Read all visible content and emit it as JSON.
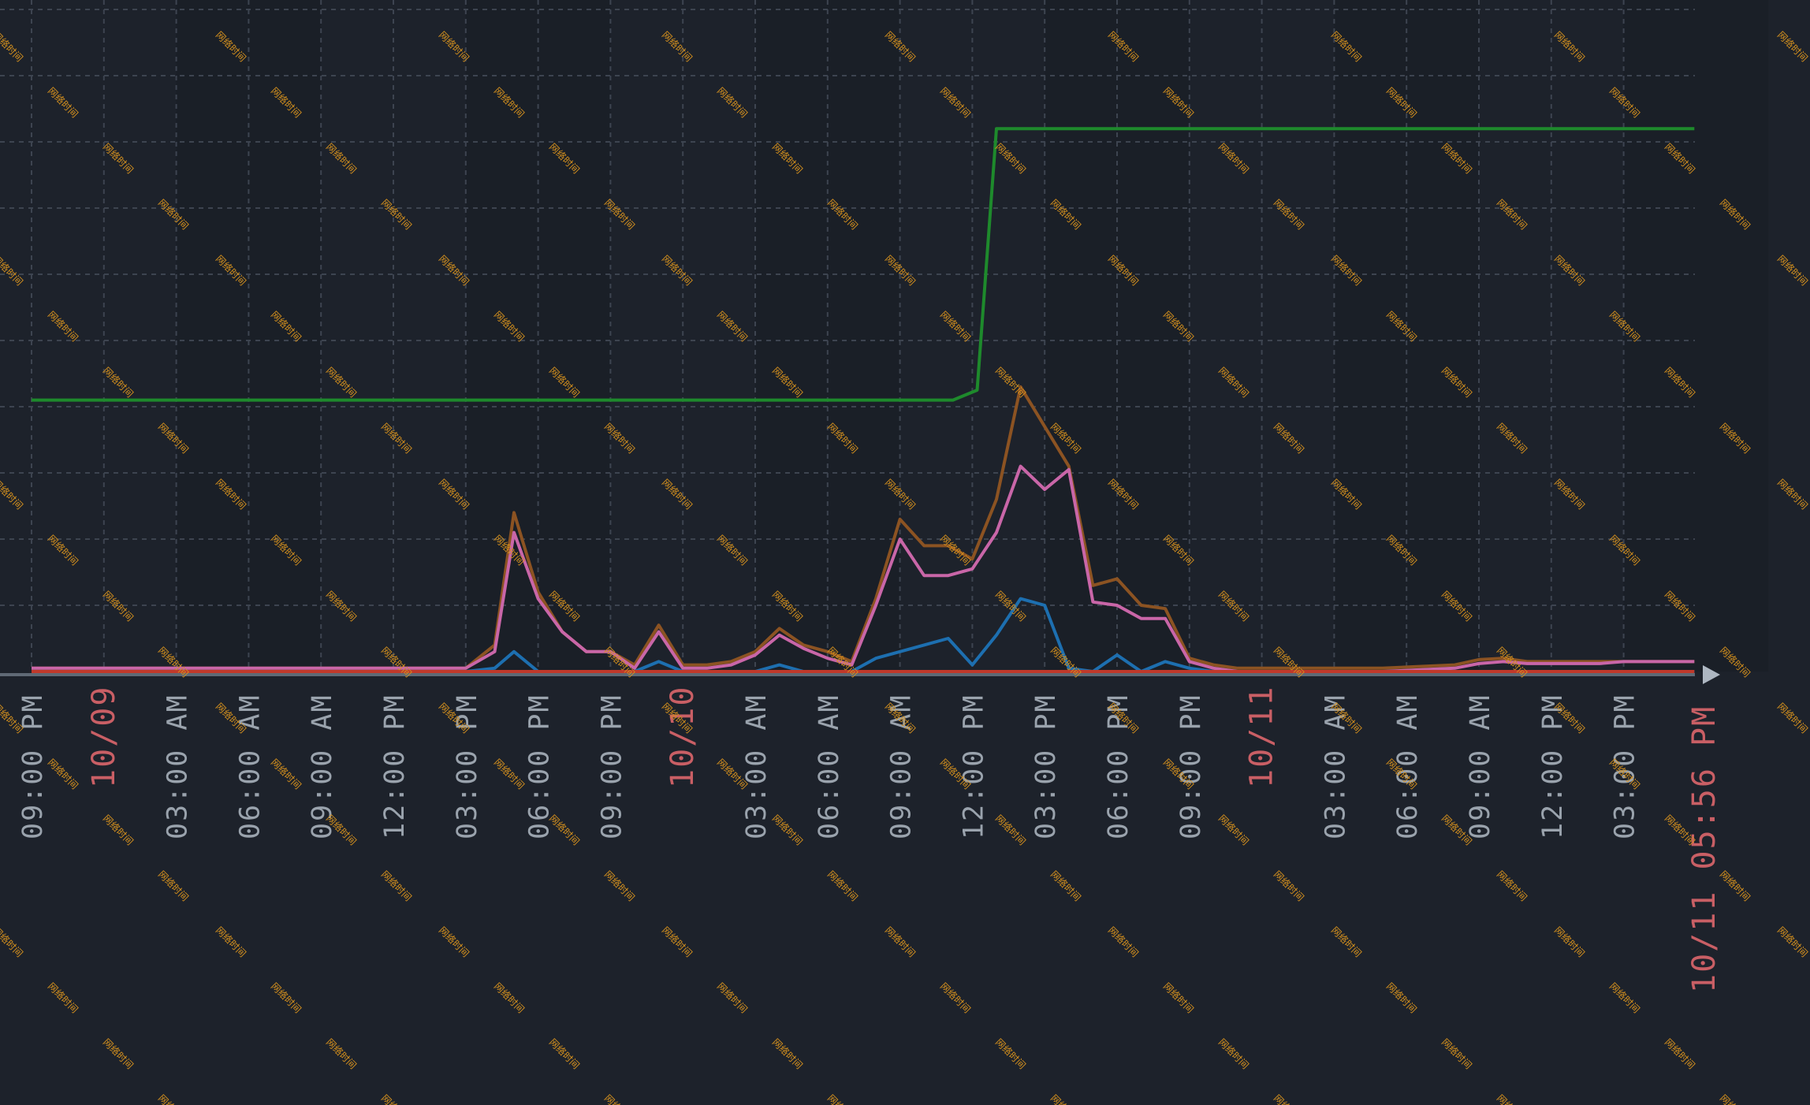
{
  "chart_data": {
    "type": "line",
    "x_labels": [
      {
        "text": "09:00 PM",
        "style": "time"
      },
      {
        "text": "10/09",
        "style": "date"
      },
      {
        "text": "03:00 AM",
        "style": "time"
      },
      {
        "text": "06:00 AM",
        "style": "time"
      },
      {
        "text": "09:00 AM",
        "style": "time"
      },
      {
        "text": "12:00 PM",
        "style": "time"
      },
      {
        "text": "03:00 PM",
        "style": "time"
      },
      {
        "text": "06:00 PM",
        "style": "time"
      },
      {
        "text": "09:00 PM",
        "style": "time"
      },
      {
        "text": "10/10",
        "style": "date"
      },
      {
        "text": "03:00 AM",
        "style": "time"
      },
      {
        "text": "06:00 AM",
        "style": "time"
      },
      {
        "text": "09:00 AM",
        "style": "time"
      },
      {
        "text": "12:00 PM",
        "style": "time"
      },
      {
        "text": "03:00 PM",
        "style": "time"
      },
      {
        "text": "06:00 PM",
        "style": "time"
      },
      {
        "text": "09:00 PM",
        "style": "time"
      },
      {
        "text": "10/11",
        "style": "date"
      },
      {
        "text": "03:00 AM",
        "style": "time"
      },
      {
        "text": "06:00 AM",
        "style": "time"
      },
      {
        "text": "09:00 AM",
        "style": "time"
      },
      {
        "text": "12:00 PM",
        "style": "time"
      },
      {
        "text": "03:00 PM",
        "style": "time"
      }
    ],
    "x_end_label": "10/11 05:56 PM",
    "x_range_hours": [
      0,
      68.93
    ],
    "y_range": [
      0,
      10
    ],
    "grid": true,
    "legend": "none",
    "series": [
      {
        "color": "#1e8a2c",
        "x": [
          0,
          38.2,
          39.2,
          40,
          41,
          68.93
        ],
        "y": [
          4.1,
          4.1,
          4.25,
          8.2,
          8.2,
          8.2
        ]
      },
      {
        "color": "#8c5322",
        "x": [
          0,
          18,
          19.2,
          20,
          21,
          22,
          23,
          24,
          25,
          26,
          27,
          28,
          29,
          30,
          31,
          32,
          33,
          34,
          35,
          36,
          37,
          38,
          39,
          40,
          41,
          42,
          43,
          44,
          45,
          46,
          47,
          48,
          49,
          50,
          51,
          52,
          56,
          59,
          60,
          61,
          62,
          63,
          64,
          65,
          66,
          67,
          68.93
        ],
        "y": [
          0.05,
          0.05,
          0.4,
          2.4,
          1.2,
          0.6,
          0.3,
          0.3,
          0.1,
          0.7,
          0.1,
          0.1,
          0.15,
          0.3,
          0.65,
          0.4,
          0.3,
          0.15,
          1.1,
          2.3,
          1.9,
          1.9,
          1.7,
          2.6,
          4.3,
          3.7,
          3.1,
          1.3,
          1.4,
          1.0,
          0.95,
          0.2,
          0.1,
          0.05,
          0.05,
          0.05,
          0.05,
          0.1,
          0.18,
          0.2,
          0.15,
          0.15,
          0.15,
          0.15,
          0.15,
          0.15,
          0.15
        ]
      },
      {
        "color": "#c966a8",
        "x": [
          0,
          18,
          19.2,
          20,
          21,
          22,
          23,
          24,
          25,
          26,
          27,
          28,
          29,
          30,
          31,
          32,
          33,
          34,
          35,
          36,
          37,
          38,
          39,
          40,
          41,
          42,
          43,
          44,
          45,
          46,
          47,
          48,
          49,
          50,
          51,
          52,
          56,
          59,
          60,
          61,
          62,
          63,
          64,
          65,
          66,
          67,
          68.93
        ],
        "y": [
          0.05,
          0.05,
          0.3,
          2.1,
          1.1,
          0.6,
          0.3,
          0.3,
          0.05,
          0.6,
          0.05,
          0.05,
          0.1,
          0.25,
          0.55,
          0.35,
          0.2,
          0.1,
          1.0,
          2.0,
          1.45,
          1.45,
          1.55,
          2.1,
          3.1,
          2.75,
          3.05,
          1.05,
          1.0,
          0.8,
          0.8,
          0.15,
          0.05,
          0.0,
          0.0,
          0.0,
          0.0,
          0.05,
          0.12,
          0.15,
          0.12,
          0.12,
          0.12,
          0.12,
          0.15,
          0.15,
          0.15
        ]
      },
      {
        "color": "#1d6fb0",
        "x": [
          0,
          18,
          19.2,
          20,
          21,
          24,
          25,
          26,
          27,
          30,
          31,
          32,
          33,
          34,
          35,
          36,
          37,
          38,
          39,
          40,
          41,
          42,
          43,
          44,
          45,
          46,
          47,
          48,
          49,
          50,
          68.93
        ],
        "y": [
          0.0,
          0.0,
          0.05,
          0.3,
          0.0,
          0.0,
          0.0,
          0.15,
          0.0,
          0.0,
          0.1,
          0.0,
          0.0,
          0.0,
          0.2,
          0.3,
          0.4,
          0.5,
          0.1,
          0.55,
          1.1,
          1.0,
          0.05,
          0.0,
          0.25,
          0.0,
          0.15,
          0.05,
          0.0,
          0.0,
          0.0
        ]
      },
      {
        "color": "#c0392b",
        "x": [
          0,
          68.93
        ],
        "y": [
          0.0,
          0.0
        ]
      }
    ]
  },
  "watermark": "网络时间"
}
